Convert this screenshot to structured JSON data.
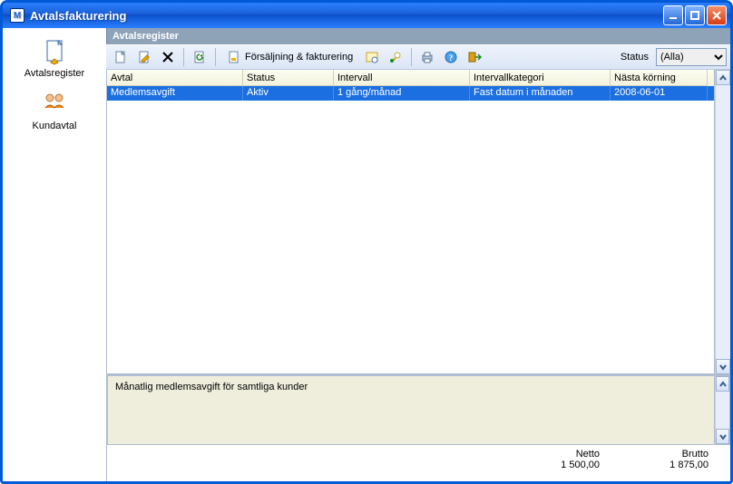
{
  "window": {
    "title": "Avtalsfakturering"
  },
  "sidebar": {
    "items": [
      {
        "label": "Avtalsregister"
      },
      {
        "label": "Kundavtal"
      }
    ]
  },
  "main": {
    "panel_title": "Avtalsregister",
    "toolbar": {
      "sales_label": "Försäljning & fakturering",
      "status_label": "Status",
      "status_selected": "(Alla)",
      "status_options": [
        "(Alla)"
      ]
    },
    "columns": [
      {
        "label": "Avtal"
      },
      {
        "label": "Status"
      },
      {
        "label": "Intervall"
      },
      {
        "label": "Intervallkategori"
      },
      {
        "label": "Nästa körning"
      }
    ],
    "rows": [
      {
        "avtal": "Medlemsavgift",
        "status": "Aktiv",
        "intervall": "1 gång/månad",
        "intervallkategori": "Fast datum i månaden",
        "nasta_korning": "2008-06-01",
        "selected": true
      }
    ],
    "description": "Månatlig medlemsavgift för samtliga kunder",
    "footer": {
      "netto_label": "Netto",
      "netto_value": "1 500,00",
      "brutto_label": "Brutto",
      "brutto_value": "1 875,00"
    }
  }
}
